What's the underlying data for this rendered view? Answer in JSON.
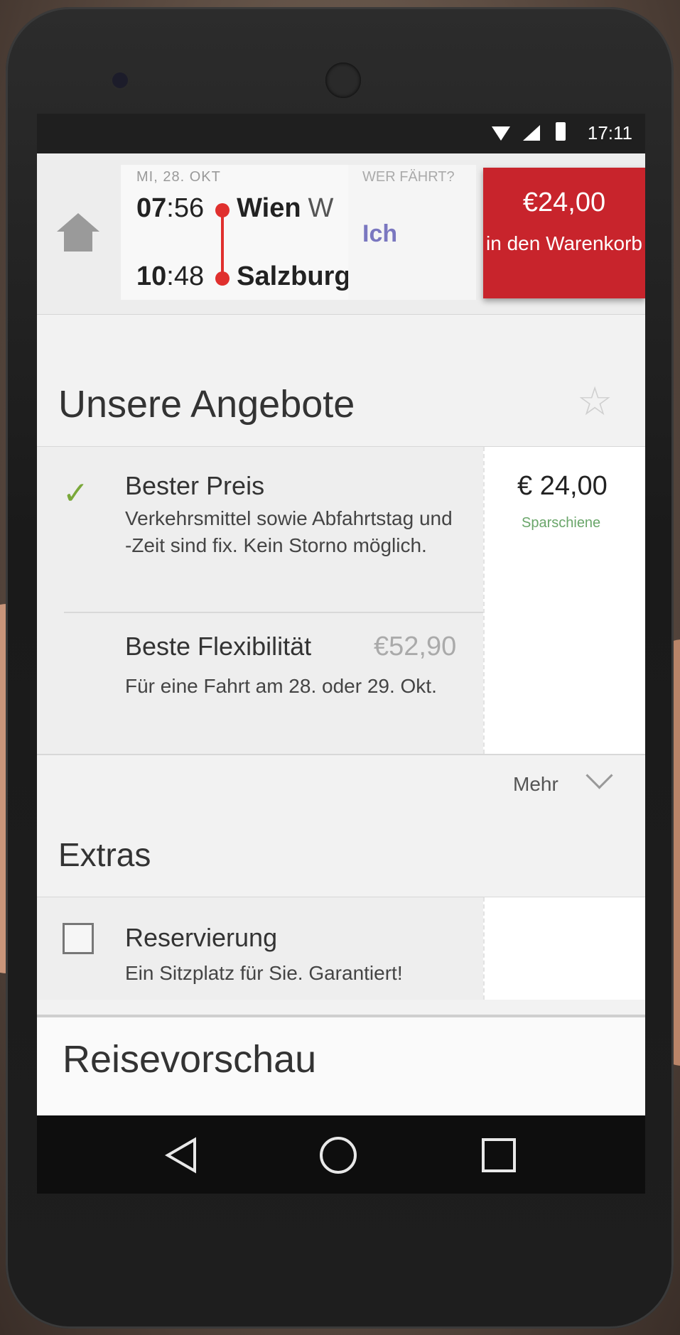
{
  "status_bar": {
    "time": "17:11"
  },
  "journey": {
    "date": "MI, 28. OKT",
    "departure_hour": "07",
    "departure_min": ":56",
    "departure_city": "Wien",
    "departure_city_cont": "W",
    "arrival_hour": "10",
    "arrival_min": ":48",
    "arrival_city": "Salzburg"
  },
  "traveller": {
    "label": "WER FÄHRT?",
    "value": "Ich"
  },
  "cart": {
    "price": "€24,00",
    "label": "in den Warenkorb"
  },
  "offers_section": {
    "title": "Unsere Angebote",
    "items": [
      {
        "title": "Bester Preis",
        "description": "Verkehrsmittel sowie Abfahrtstag und -Zeit sind fix. Kein Storno möglich.",
        "price": "€ 24,00",
        "tag": "Sparschiene"
      },
      {
        "title": "Beste Flexibilität",
        "description": "Für eine Fahrt am 28. oder 29. Okt.",
        "price": "€52,90"
      }
    ],
    "more_label": "Mehr"
  },
  "extras_section": {
    "title": "Extras",
    "items": [
      {
        "title": "Reservierung",
        "description": "Ein Sitzplatz für Sie. Garantiert!"
      }
    ]
  },
  "preview_section": {
    "title": "Reisevorschau"
  },
  "colors": {
    "accent_red": "#c8242c",
    "check_green": "#7aa83a",
    "traveller_purple": "#7a77c0"
  },
  "icons": [
    "home-icon",
    "star-icon",
    "check-icon",
    "chevron-down-icon",
    "checkbox-icon",
    "back-icon",
    "home-nav-icon",
    "recents-icon"
  ]
}
